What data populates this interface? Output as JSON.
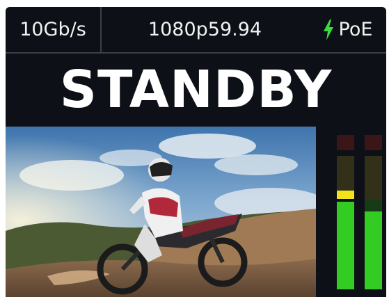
{
  "status_bar": {
    "link_speed": "10Gb/s",
    "video_format": "1080p59.94",
    "power_label": "PoE",
    "power_icon": "lightning-bolt-icon",
    "power_icon_color": "#3ddc3d"
  },
  "state": {
    "label": "STANDBY",
    "color": "#ffffff"
  },
  "preview": {
    "subject": "motocross-rider-on-dirt-bike",
    "background": "#0d1117"
  },
  "audio_meters": {
    "channels": [
      {
        "id": "left",
        "level": 0.62,
        "peak_hold": true
      },
      {
        "id": "right",
        "level": 0.51,
        "peak_hold": false
      }
    ],
    "colors": {
      "green": "#33cc22",
      "yellow": "#f2e21c",
      "red_dim": "#3b1518",
      "yellow_dim": "#33301a",
      "green_dim": "#173a17"
    }
  }
}
